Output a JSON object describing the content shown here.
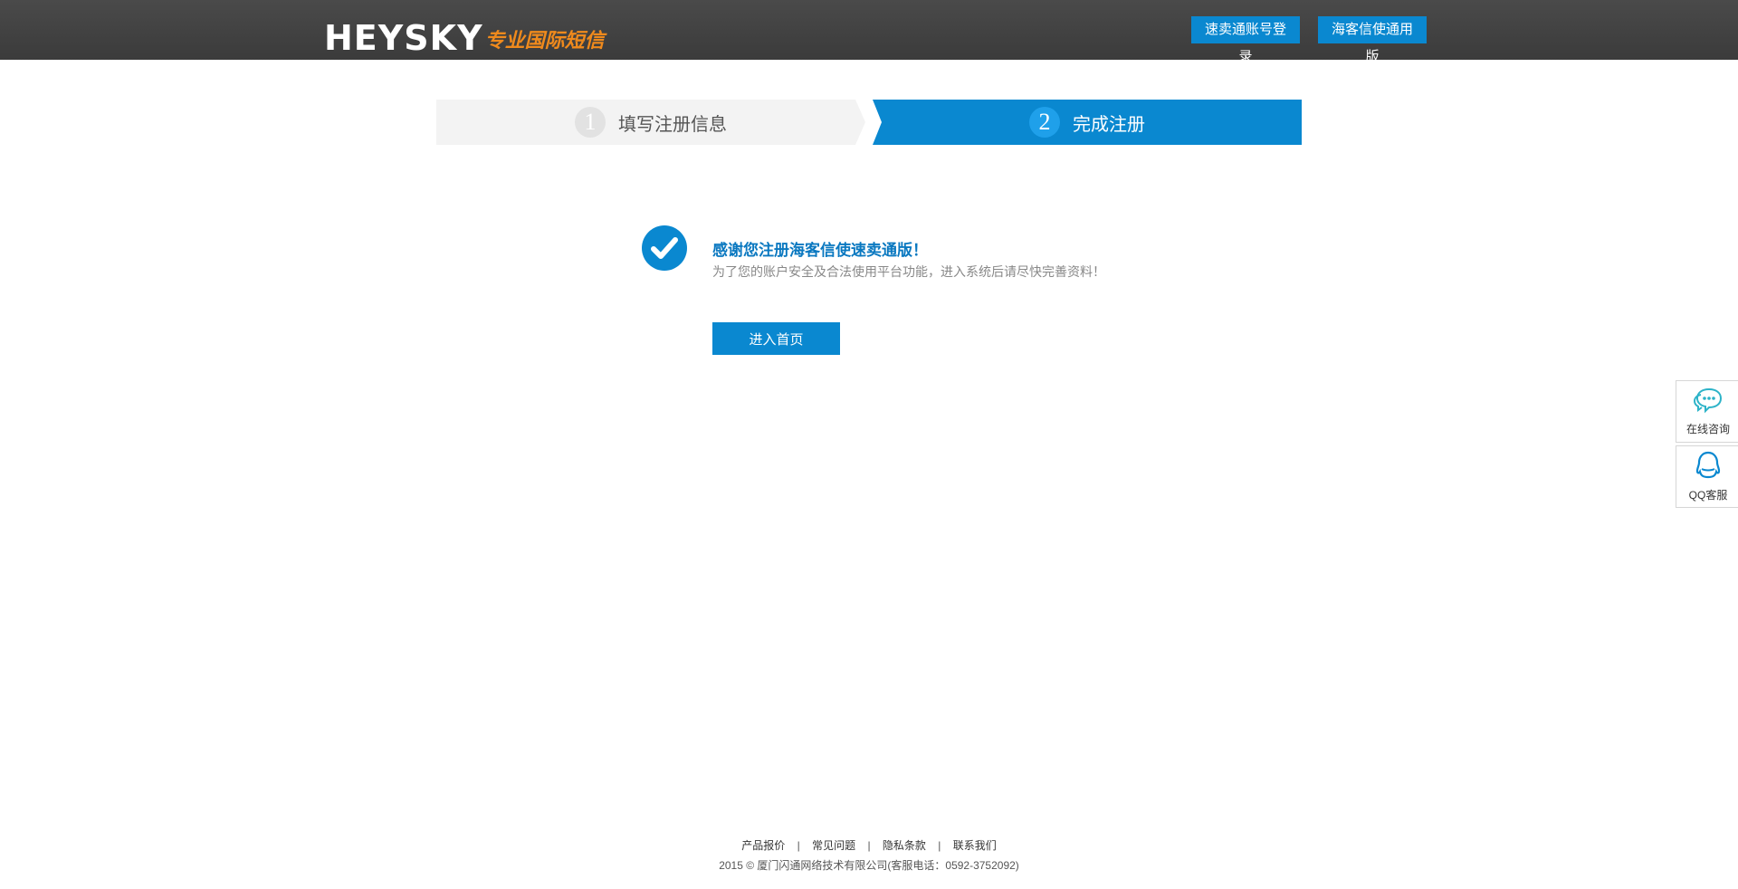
{
  "header": {
    "logo_text": "HEYSKY",
    "logo_tagline": "专业国际短信",
    "login_button": "速卖通账号登录",
    "general_button": "海客信使通用版"
  },
  "steps": [
    {
      "number": "1",
      "label": "填写注册信息"
    },
    {
      "number": "2",
      "label": "完成注册"
    }
  ],
  "success": {
    "title": "感谢您注册海客信使速卖通版！",
    "description": "为了您的账户安全及合法使用平台功能，进入系统后请尽快完善资料！",
    "home_button": "进入首页"
  },
  "side_panel": {
    "online_consult": "在线咨询",
    "qq_service": "QQ客服"
  },
  "footer": {
    "links": [
      "产品报价",
      "常见问题",
      "隐私条款",
      "联系我们"
    ],
    "separator": "|",
    "copyright": "2015 © 厦门闪通网络技术有限公司(客服电话：0592-3752092)"
  },
  "colors": {
    "accent": "#0a88d0",
    "header_bg": "#3f3f3f",
    "logo_orange": "#f08a1c",
    "step_inactive": "#f3f3f3"
  },
  "icons": {
    "check": "check-icon",
    "chat": "chat-bubble-icon",
    "qq": "qq-penguin-icon"
  }
}
